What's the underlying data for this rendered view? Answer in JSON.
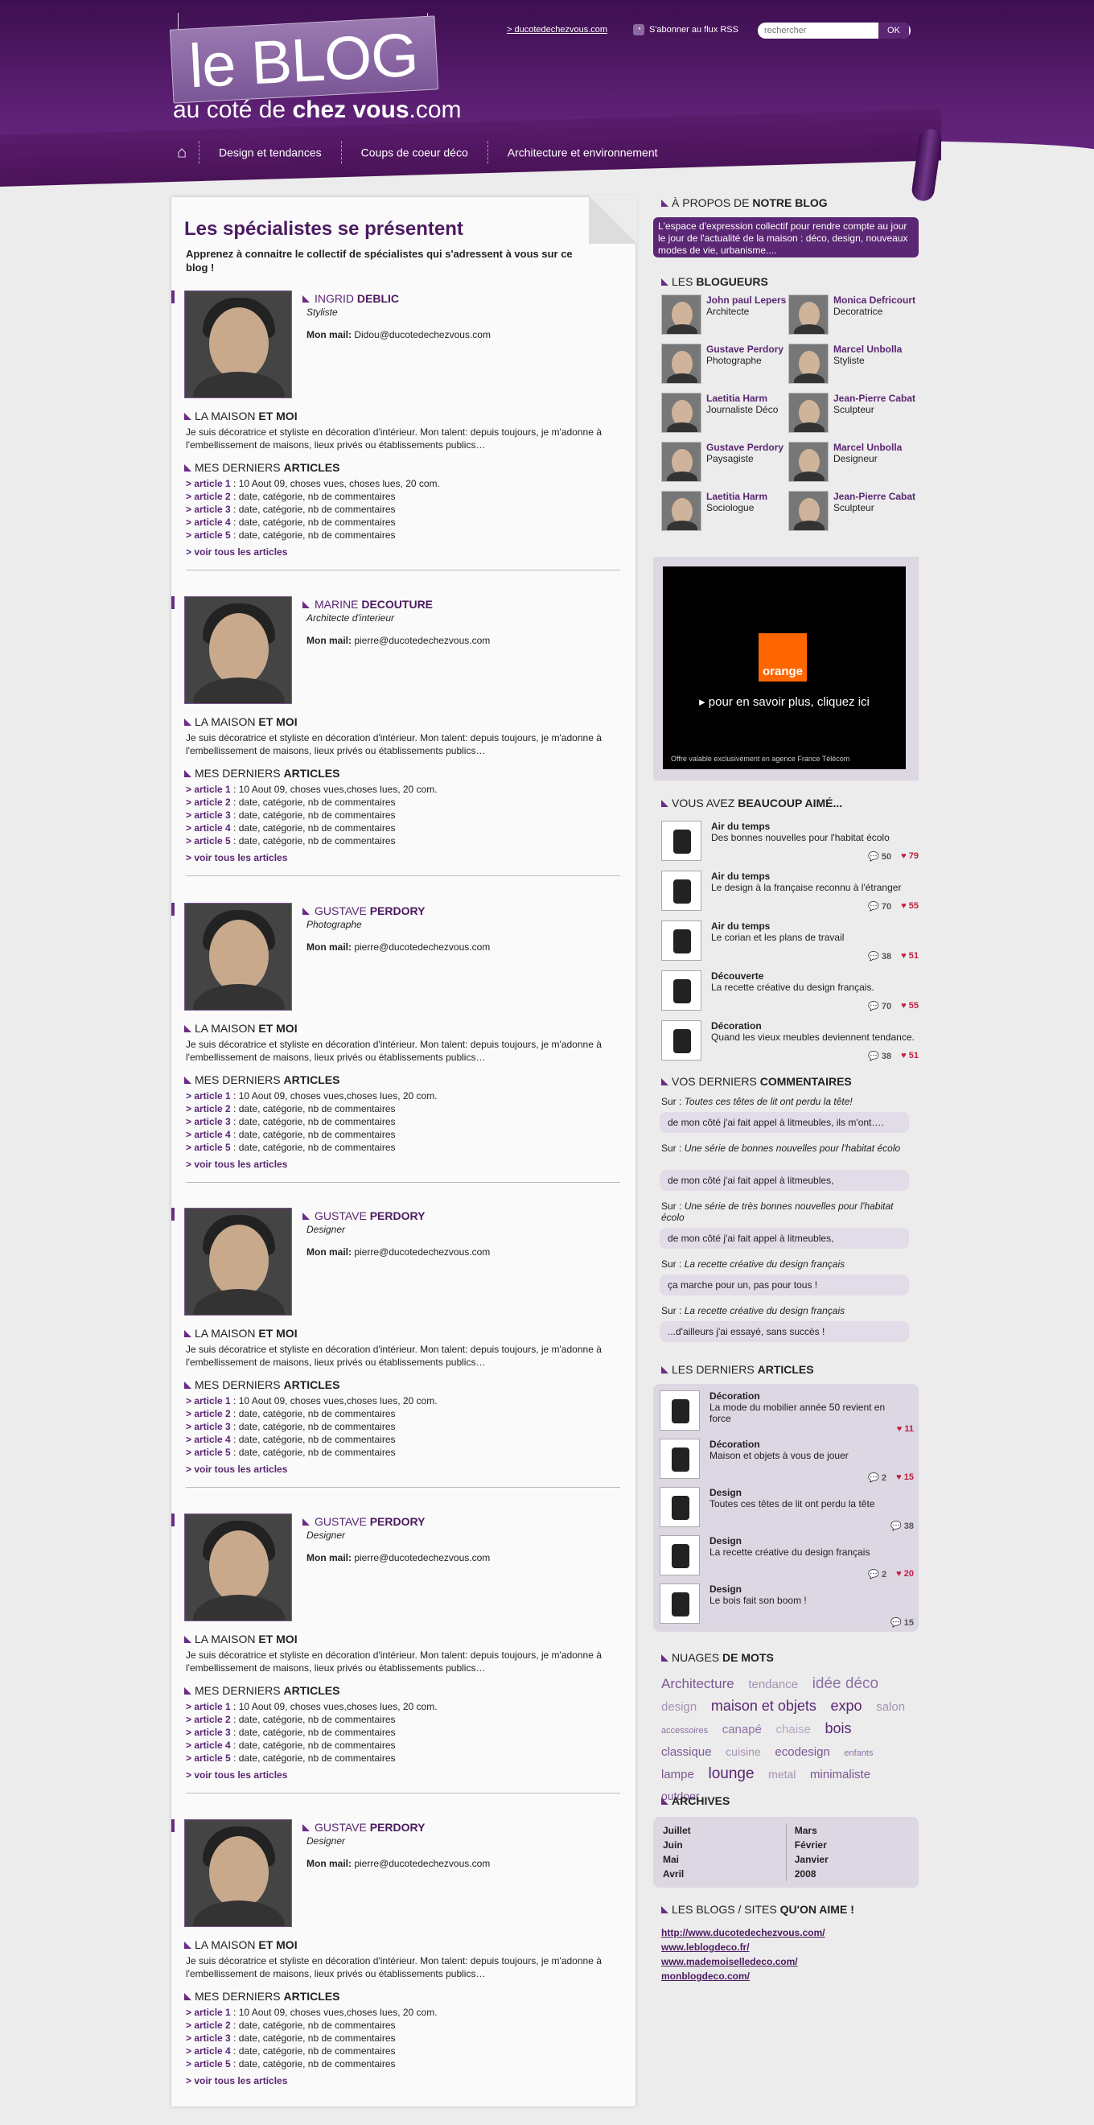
{
  "header": {
    "logo_big": "le BLOG",
    "logo_small_prefix": "au coté de ",
    "logo_small_bold": "chez vous",
    "logo_small_suffix": ".com",
    "top_link": "> ducotedechezvous.com",
    "rss_label": "S'abonner au flux RSS",
    "search_placeholder": "rechercher",
    "search_button": "OK"
  },
  "nav": {
    "items": [
      "Design et tendances",
      "Coups de coeur déco",
      "Architecture et environnement"
    ]
  },
  "main": {
    "title": "Les spécialistes se présentent",
    "intro": "Apprenez à connaitre le collectif de spécialistes qui s'adressent à vous sur ce blog !",
    "section_maison_a": "LA MAISON ",
    "section_maison_b": "ET MOI",
    "section_articles_a": "MES DERNIERS ",
    "section_articles_b": "ARTICLES",
    "mail_label": "Mon mail:",
    "view_all": "> voir tous les articles",
    "bio": "Je suis décoratrice et styliste en décoration d'intérieur. Mon talent: depuis toujours, je m'adonne à l'embellissement de maisons, lieux privés ou établissements publics…",
    "profiles": [
      {
        "first": "INGRID",
        "last": "DEBLIC",
        "role": "Styliste",
        "mail": "Didou@ducotedechezvous.com",
        "articles": [
          "10 Aout 09, choses vues, choses lues, 20 com.",
          "date, catégorie, nb de commentaires",
          "date, catégorie, nb de commentaires",
          "date, catégorie, nb de commentaires",
          "date, catégorie, nb de commentaires"
        ]
      },
      {
        "first": "MARINE",
        "last": "DECOUTURE",
        "role": "Architecte d'interieur",
        "mail": "pierre@ducotedechezvous.com",
        "articles": [
          "10 Aout 09, choses vues,choses lues, 20 com.",
          "date, catégorie, nb de commentaires",
          "date, catégorie, nb de commentaires",
          "date, catégorie, nb de commentaires",
          "date, catégorie, nb de commentaires"
        ]
      },
      {
        "first": "GUSTAVE",
        "last": "PERDORY",
        "role": "Photographe",
        "mail": "pierre@ducotedechezvous.com",
        "articles": [
          "10 Aout 09, choses vues,choses lues, 20 com.",
          "date, catégorie, nb de commentaires",
          "date, catégorie, nb de commentaires",
          "date, catégorie, nb de commentaires",
          "date, catégorie, nb de commentaires"
        ]
      },
      {
        "first": "GUSTAVE",
        "last": "PERDORY",
        "role": "Designer",
        "mail": "pierre@ducotedechezvous.com",
        "articles": [
          "10 Aout 09, choses vues,choses lues, 20 com.",
          "date, catégorie, nb de commentaires",
          "date, catégorie, nb de commentaires",
          "date, catégorie, nb de commentaires",
          "date, catégorie, nb de commentaires"
        ]
      },
      {
        "first": "GUSTAVE",
        "last": "PERDORY",
        "role": "Designer",
        "mail": "pierre@ducotedechezvous.com",
        "articles": [
          "10 Aout 09, choses vues,choses lues, 20 com.",
          "date, catégorie, nb de commentaires",
          "date, catégorie, nb de commentaires",
          "date, catégorie, nb de commentaires",
          "date, catégorie, nb de commentaires"
        ]
      },
      {
        "first": "GUSTAVE",
        "last": "PERDORY",
        "role": "Designer",
        "mail": "pierre@ducotedechezvous.com",
        "articles": [
          "10 Aout 09, choses vues,choses lues, 20 com.",
          "date, catégorie, nb de commentaires",
          "date, catégorie, nb de commentaires",
          "date, catégorie, nb de commentaires",
          "date, catégorie, nb de commentaires"
        ]
      }
    ]
  },
  "sidebar": {
    "about_title_a": "À PROPOS DE ",
    "about_title_b": "NOTRE BLOG",
    "about_text": "L'espace d'expression collectif pour rendre compte au jour le jour de l'actualité de la maison : déco, design, nouveaux modes de vie, urbanisme....",
    "bloggers_title_a": "LES ",
    "bloggers_title_b": "BLOGUEURS",
    "bloggers": [
      {
        "name": "John paul Lepers",
        "role": "Architecte"
      },
      {
        "name": "Monica Defricourt",
        "role": "Decoratrice"
      },
      {
        "name": "Gustave Perdory",
        "role": "Photographe"
      },
      {
        "name": "Marcel Unbolla",
        "role": "Styliste"
      },
      {
        "name": "Laetitia Harm",
        "role": "Journaliste Déco"
      },
      {
        "name": "Jean-Pierre Cabat",
        "role": "Sculpteur"
      },
      {
        "name": "Gustave Perdory",
        "role": "Paysagiste"
      },
      {
        "name": "Marcel Unbolla",
        "role": "Designeur"
      },
      {
        "name": "Laetitia Harm",
        "role": "Sociologue"
      },
      {
        "name": "Jean-Pierre Cabat",
        "role": "Sculpteur"
      }
    ],
    "ad": {
      "brand": "orange",
      "cta": "▸ pour en savoir plus, cliquez ici",
      "legal": "Offre valable exclusivement en agence France Télécom"
    },
    "liked_title_a": "VOUS AVEZ ",
    "liked_title_b": "BEAUCOUP AIMÉ...",
    "liked": [
      {
        "cat": "Air du temps",
        "desc": "Des bonnes nouvelles pour l'habitat écolo",
        "comments": "50",
        "likes": "79"
      },
      {
        "cat": "Air du temps",
        "desc": "Le design à la française reconnu à l'étranger",
        "comments": "70",
        "likes": "55"
      },
      {
        "cat": "Air du temps",
        "desc": "Le corian et les plans de travail",
        "comments": "38",
        "likes": "51"
      },
      {
        "cat": "Découverte",
        "desc": "La recette créative du design français.",
        "comments": "70",
        "likes": "55"
      },
      {
        "cat": "Décoration",
        "desc": "Quand les vieux meubles deviennent tendance.",
        "comments": "38",
        "likes": "51"
      }
    ],
    "comments_title_a": "VOS DERNIERS ",
    "comments_title_b": "COMMENTAIRES",
    "sur_label": "Sur :",
    "comments": [
      {
        "topic": "Toutes ces têtes de lit ont perdu la tête!",
        "text": "de mon côté j'ai fait appel à litmeubles, ils m'ont…."
      },
      {
        "topic": "Une série de bonnes nouvelles pour l'habitat écolo",
        "text": "de mon côté j'ai fait appel à litmeubles,"
      },
      {
        "topic": "Une série de très bonnes nouvelles pour l'habitat écolo",
        "text": "de mon côté j'ai fait appel à litmeubles,"
      },
      {
        "topic": "La recette créative du design français",
        "text": "ça marche pour un, pas pour tous !"
      },
      {
        "topic": "La recette créative du design français",
        "text": "...d'ailleurs j'ai essayé, sans succès !"
      }
    ],
    "lastart_title_a": "LES DERNIERS ",
    "lastart_title_b": "ARTICLES",
    "last_articles": [
      {
        "cat": "Décoration",
        "desc": "La mode du mobilier année 50 revient en force",
        "comments": "",
        "likes": "11"
      },
      {
        "cat": "Décoration",
        "desc": "Maison et objets à vous de jouer",
        "comments": "2",
        "likes": "15"
      },
      {
        "cat": "Design",
        "desc": "Toutes ces têtes de lit ont perdu la tête",
        "comments": "38",
        "likes": ""
      },
      {
        "cat": "Design",
        "desc": "La recette créative du design français",
        "comments": "2",
        "likes": "20"
      },
      {
        "cat": "Design",
        "desc": "Le bois fait son boom !",
        "comments": "15",
        "likes": ""
      }
    ],
    "cloud_title_a": "NUAGES ",
    "cloud_title_b": "DE MOTS",
    "cloud": [
      {
        "w": "Architecture",
        "size": 17,
        "color": "#7b5796"
      },
      {
        "w": "tendance",
        "size": 15,
        "color": "#a491b5"
      },
      {
        "w": "idée déco",
        "size": 19,
        "color": "#8e72a6"
      },
      {
        "w": "design",
        "size": 15,
        "color": "#a491b5"
      },
      {
        "w": "maison et objets",
        "size": 18,
        "color": "#5a2673"
      },
      {
        "w": "expo",
        "size": 18,
        "color": "#5a2673"
      },
      {
        "w": "salon",
        "size": 15,
        "color": "#a491b5"
      },
      {
        "w": "accessoires",
        "size": 11,
        "color": "#8e72a6"
      },
      {
        "w": "canapé",
        "size": 15,
        "color": "#8e72a6"
      },
      {
        "w": "chaise",
        "size": 15,
        "color": "#b6a6c4"
      },
      {
        "w": "bois",
        "size": 18,
        "color": "#5a2673"
      },
      {
        "w": "classique",
        "size": 15,
        "color": "#7b5796"
      },
      {
        "w": "cuisine",
        "size": 14,
        "color": "#a491b5"
      },
      {
        "w": "ecodesign",
        "size": 15,
        "color": "#7b5796"
      },
      {
        "w": "enfants",
        "size": 11,
        "color": "#8e72a6"
      },
      {
        "w": "lampe",
        "size": 15,
        "color": "#7b5796"
      },
      {
        "w": "lounge",
        "size": 19,
        "color": "#5a2673"
      },
      {
        "w": "metal",
        "size": 14,
        "color": "#a491b5"
      },
      {
        "w": "minimaliste",
        "size": 15,
        "color": "#7b5796"
      },
      {
        "w": "outdoor",
        "size": 14,
        "color": "#7b5796"
      }
    ],
    "archives_title": "ARCHIVES",
    "archives_col1": [
      "Juillet",
      "Juin",
      "Mai",
      "Avril"
    ],
    "archives_col2": [
      "Mars",
      "Février",
      "Janvier",
      "2008"
    ],
    "links_title_a": "LES BLOGS / SITES ",
    "links_title_b": "QU'ON AIME !",
    "links": [
      "http://www.ducotedechezvous.com/",
      "www.leblogdeco.fr/",
      "www.mademoiselledeco.com/",
      "monblogdeco.com/"
    ]
  }
}
